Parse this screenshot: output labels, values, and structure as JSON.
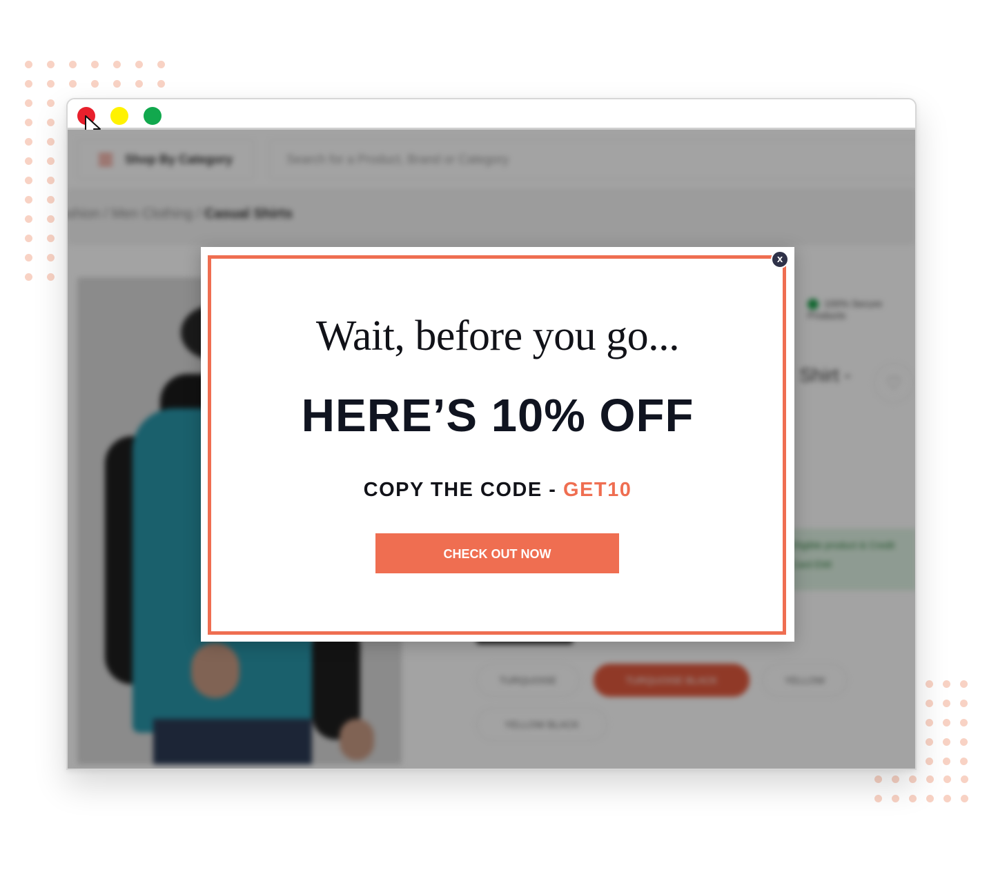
{
  "window": {
    "controls": {
      "close_color": "#e8202c",
      "minimize_color": "#fff200",
      "maximize_color": "#11a84d"
    }
  },
  "site": {
    "category_button": "Shop By Category",
    "search_placeholder": "Search for a Product, Brand or Category",
    "breadcrumb": {
      "part1": "ashion / Men Clothing / ",
      "current": "Casual Shirts"
    },
    "secure_label": "100% Secure Products",
    "title_fragment": "Shirt -",
    "emi_text": "Eligible product & Credit Card EMI",
    "color_options": [
      "TURQUOISE",
      "TURQUOISE BLACK",
      "YELLOW",
      "YELLOW BLACK"
    ],
    "active_color": "TURQUOISE BLACK"
  },
  "popup": {
    "close_label": "x",
    "headline": "Wait, before you go...",
    "offer": "HERE’S 10% OFF",
    "code_prefix": "COPY THE CODE - ",
    "code": "GET10",
    "cta_label": "CHECK OUT NOW",
    "accent_color": "#ef6e51"
  }
}
